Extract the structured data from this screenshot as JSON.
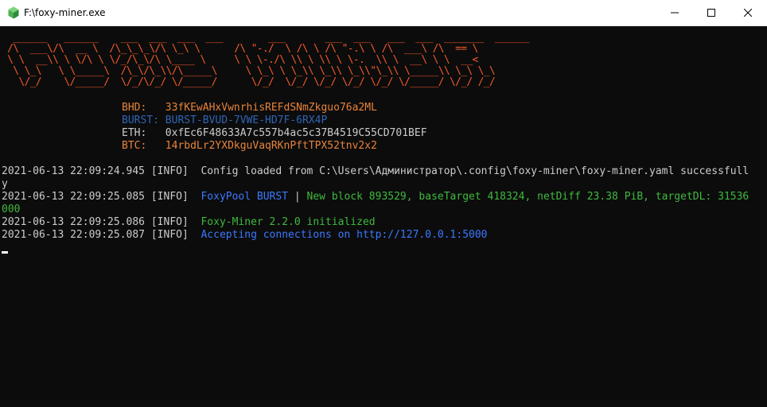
{
  "window": {
    "title": "F:\\foxy-miner.exe",
    "icon": "hexagon-app-icon",
    "controls": [
      "minimize-icon",
      "maximize-icon",
      "close-icon"
    ]
  },
  "banner": {
    "art": "  ______   ______    ___  ___  ___  ___        ___       ___  ___   ___  ___  _______  ______\n /\\  ___\\/\\  __ \\  /\\_\\_\\_\\/\\ \\_\\ \\      /\\ \"-./  \\ /\\ \\ /\\ \"-.\\ \\ /\\  ___\\ /\\  == \\\n \\ \\  __\\\\ \\ \\/\\ \\ \\/_/\\_\\/\\ \\____ \\     \\ \\ \\-./\\ \\\\ \\ \\\\ \\ \\-.  \\\\ \\  __\\ \\ \\  __<\n  \\ \\_\\   \\ \\_____\\  /\\_\\/\\_\\\\/\\_____\\     \\ \\_\\ \\ \\_\\\\ \\_\\\\ \\_\\\\\"\\_\\\\ \\_____\\\\ \\_\\ \\_\\\n   \\/_/    \\/_____/  \\/_/\\/_/ \\/_____/      \\/_/  \\/_/ \\/_/ \\/_/ \\/_/ \\/_____/ \\/_/ /_/",
    "color": "#f15a2a"
  },
  "addresses": [
    {
      "label": "BHD:",
      "value": "33fKEwAHxVwnrhisREFdSNmZkguo76a2ML",
      "color": "#e8843c"
    },
    {
      "label": "BURST:",
      "value": "BURST-BVUD-7VWE-HD7F-6RX4P",
      "color": "#2f65b5"
    },
    {
      "label": "ETH:",
      "value": "0xfEc6F48633A7c557b4ac5c37B4519C55CD701BEF",
      "color": "#cccccc"
    },
    {
      "label": "BTC:",
      "value": "14rbdLr2YXDkguVaqRKnPftTPX52tnv2x2",
      "color": "#e8843c"
    }
  ],
  "log": [
    {
      "ts": "2021-06-13 22:09:24.945",
      "level": "[INFO]",
      "message": "Config loaded from C:\\Users\\Администратор\\.config\\foxy-miner\\foxy-miner.yaml successfull",
      "wrap": "y"
    },
    {
      "ts": "2021-06-13 22:09:25.085",
      "level": "[INFO]",
      "pool": "FoxyPool BURST",
      "sep": "|",
      "message": "New block 893529, baseTarget 418324, netDiff 23.38 PiB, targetDL: 31536",
      "wrap": "000"
    },
    {
      "ts": "2021-06-13 22:09:25.086",
      "level": "[INFO]",
      "message": "Foxy-Miner 2.2.0 initialized"
    },
    {
      "ts": "2021-06-13 22:09:25.087",
      "level": "[INFO]",
      "message": "Accepting connections on http://127.0.0.1:5000"
    }
  ],
  "colors": {
    "background": "#0c0c0c",
    "text": "#cccccc",
    "green": "#3fb93f",
    "blue": "#3b78ff"
  }
}
